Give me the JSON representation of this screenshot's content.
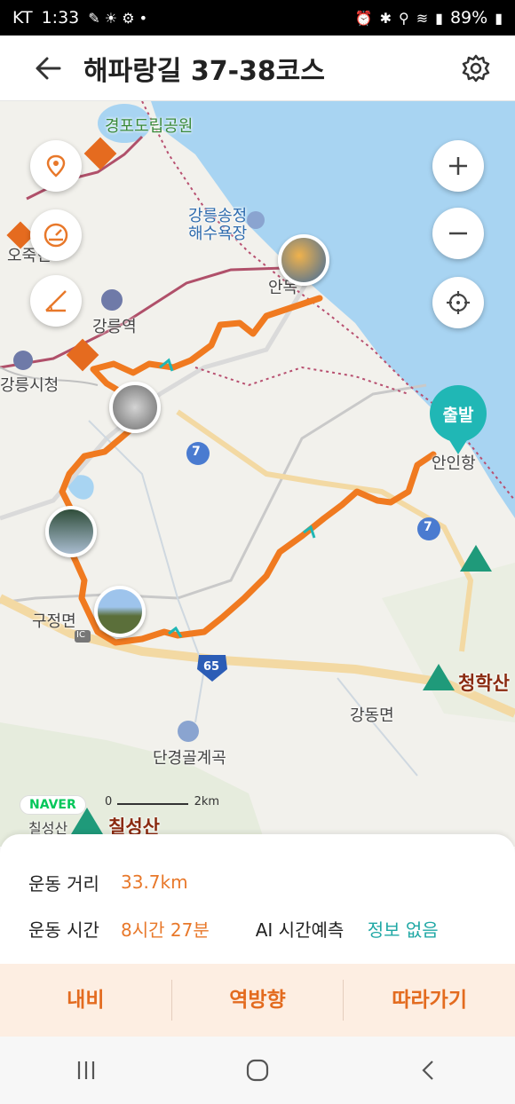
{
  "status": {
    "carrier": "KT",
    "time": "1:33",
    "battery": "89%"
  },
  "header": {
    "title": "해파랑길 37-38코스"
  },
  "map": {
    "labels": {
      "park": "경포도립공원",
      "beach": "강릉송정\n해수욕장",
      "station": "강릉역",
      "cityhall": "강릉시청",
      "okgye": "오죽헌",
      "anmok": "안목",
      "anin": "안인항",
      "gujeong": "구정면",
      "gangdong": "강동면",
      "dangyeong": "단경골계곡",
      "chilseong_small": "칠성산",
      "chilseong": "칠성산",
      "cheonghak": "청학산",
      "route7a": "7",
      "route7b": "7",
      "route65": "65",
      "ic": "IC"
    },
    "start_label": "출발",
    "naver_logo": "NAVER",
    "scale": {
      "zero": "0",
      "unit": "2km"
    }
  },
  "summary": {
    "distance_label": "운동 거리",
    "distance_value": "33.7km",
    "time_label": "운동 시간",
    "time_value": "8시간 27분",
    "ai_label": "AI 시간예측",
    "ai_value": "정보 없음"
  },
  "actions": {
    "nav": "내비",
    "reverse": "역방향",
    "follow": "따라가기"
  },
  "colors": {
    "route": "#f07a20",
    "sea": "#a8d4f2",
    "accent_teal": "#20b7b5",
    "accent_orange": "#e36b1f"
  }
}
